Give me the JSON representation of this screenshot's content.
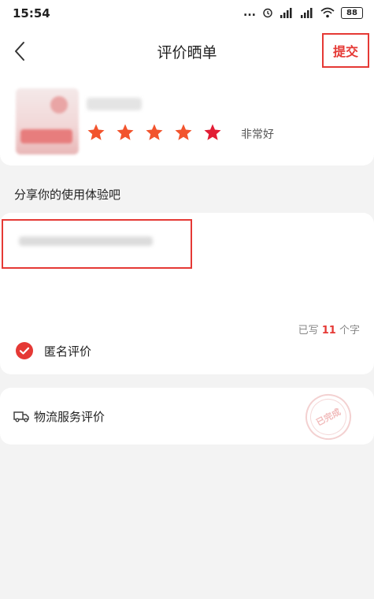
{
  "status_bar": {
    "time": "15:54",
    "dots": "...",
    "battery": "88"
  },
  "header": {
    "title": "评价晒单",
    "submit_label": "提交"
  },
  "product": {
    "rating": 5,
    "rating_text": "非常好"
  },
  "share_prompt": "分享你的使用体验吧",
  "review": {
    "char_prefix": "已写",
    "char_count": "11",
    "char_suffix": "个字"
  },
  "anonymous": {
    "label": "匿名评价",
    "checked": true
  },
  "logistics": {
    "label": "物流服务评价",
    "stamp_text": "已完成"
  },
  "colors": {
    "accent": "#e53935",
    "star": "#f2542d"
  }
}
